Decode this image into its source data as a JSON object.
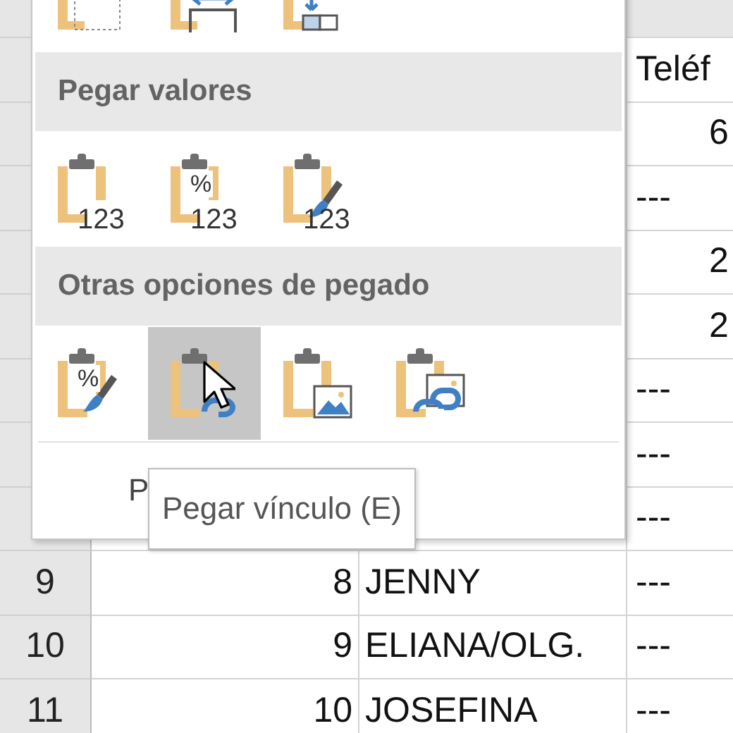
{
  "sheet": {
    "header_cell": "Teléf",
    "rows": [
      {
        "column_d": {
          "text": "6",
          "kind": "number"
        }
      },
      {
        "column_d": {
          "text": "---",
          "kind": "text"
        }
      },
      {
        "column_d": {
          "text": "2",
          "kind": "number"
        }
      },
      {
        "column_d": {
          "text": "2",
          "kind": "number"
        }
      },
      {
        "column_d": {
          "text": "---",
          "kind": "text"
        }
      },
      {
        "column_d": {
          "text": "---",
          "kind": "text"
        }
      },
      {
        "column_d": {
          "text": "---",
          "kind": "text"
        }
      },
      {
        "row": "9",
        "number": "8",
        "name": "JENNY",
        "column_d": {
          "text": "---",
          "kind": "text"
        }
      },
      {
        "row": "10",
        "number": "9",
        "name": "ELIANA/OLG.",
        "column_d": {
          "text": "---",
          "kind": "text"
        }
      },
      {
        "row": "11",
        "number": "10",
        "name": "JOSEFINA",
        "column_d": {
          "text": "---",
          "kind": "text"
        }
      }
    ]
  },
  "paste_menu": {
    "groups": [
      {
        "options": [
          {
            "kind": "dotted",
            "selected": false
          },
          {
            "kind": "widths",
            "selected": false
          },
          {
            "kind": "transpose",
            "selected": false
          }
        ]
      },
      {
        "title": "Pegar valores",
        "options": [
          {
            "kind": "plain",
            "caption": "123",
            "selected": false
          },
          {
            "kind": "plain",
            "symbol": "%",
            "caption": "123",
            "selected": false
          },
          {
            "kind": "brush",
            "caption": "123",
            "selected": false
          }
        ]
      },
      {
        "title": "Otras opciones de pegado",
        "options": [
          {
            "kind": "brush",
            "symbol": "%",
            "selected": false
          },
          {
            "kind": "link",
            "selected": true
          },
          {
            "kind": "picture",
            "selected": false
          },
          {
            "kind": "linked-picture",
            "selected": false
          }
        ]
      }
    ],
    "special_item": "P"
  },
  "tooltip": "Pegar vínculo (E)"
}
